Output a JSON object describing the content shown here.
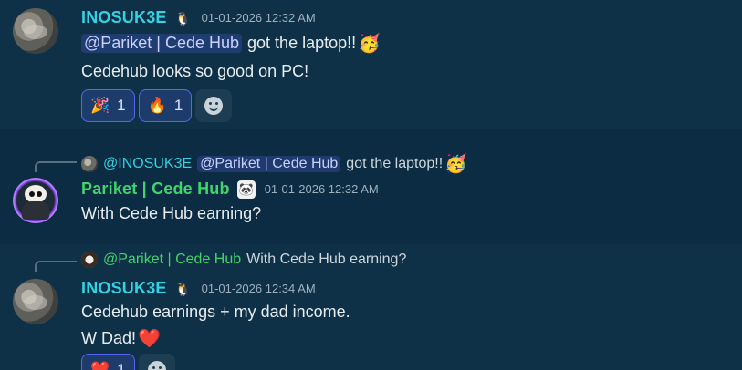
{
  "messages": [
    {
      "username": "INOSUK3E",
      "tag_icon": "penguin-badge-icon",
      "timestamp": "01-01-2026 12:32 AM",
      "line1_mention": "@Pariket | Cede Hub",
      "line1_text": "got the laptop!!",
      "line1_emoji": "🥳",
      "line2": "Cedehub looks so good on PC!",
      "reactions": [
        {
          "emoji": "🎉",
          "count": "1"
        },
        {
          "emoji": "🔥",
          "count": "1"
        }
      ]
    },
    {
      "reply": {
        "username": "@INOSUK3E",
        "mention": "@Pariket | Cede Hub",
        "text": "got the laptop!!",
        "emoji": "🥳"
      },
      "username": "Pariket | Cede Hub",
      "tag_icon": "panda-badge-icon",
      "tag_glyph": "🐼",
      "timestamp": "01-01-2026 12:32 AM",
      "text": "With Cede Hub earning?"
    },
    {
      "reply": {
        "username": "@Pariket | Cede Hub",
        "text": "With Cede Hub earning?"
      },
      "username": "INOSUK3E",
      "tag_icon": "penguin-badge-icon",
      "timestamp": "01-01-2026 12:34 AM",
      "line1": "Cedehub earnings + my dad income.",
      "line2": "W Dad!",
      "line2_emoji": "❤️",
      "reactions": [
        {
          "emoji": "❤️",
          "count": "1"
        }
      ]
    }
  ],
  "colors": {
    "background": "#0b2c42",
    "username_cyan": "#33d2e4",
    "username_green": "#3fd46c",
    "reaction_accent": "#5865f2"
  }
}
